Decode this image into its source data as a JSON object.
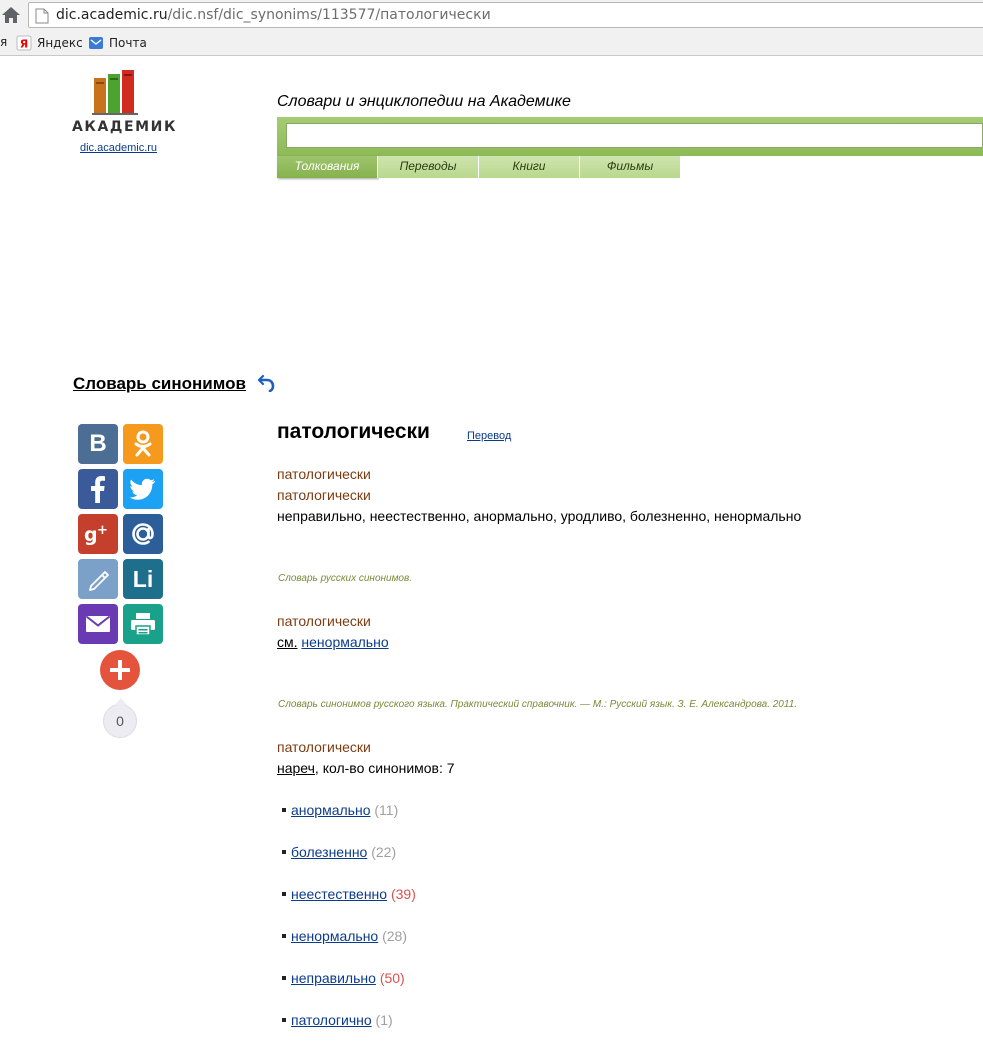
{
  "browser": {
    "url_host": "dic.academic.ru",
    "url_path": "/dic.nsf/dic_synonims/113577/патологически",
    "bookmarks": [
      {
        "label": "я"
      },
      {
        "label": "Яндекс"
      },
      {
        "label": "Почта"
      }
    ]
  },
  "header": {
    "logo_text": "АКАДЕМИК",
    "logo_link": "dic.academic.ru",
    "site_title": "Словари и энциклопедии на Академике",
    "search": {
      "value": ""
    },
    "tabs": [
      {
        "label": "Толкования"
      },
      {
        "label": "Переводы"
      },
      {
        "label": "Книги"
      },
      {
        "label": "Фильмы"
      }
    ]
  },
  "dictionary": {
    "name": "Словарь синонимов"
  },
  "social": {
    "vk": "В",
    "livejournal": "Li",
    "share_count": "0"
  },
  "article": {
    "title": "патологически",
    "translate_link": "Перевод",
    "entry1": {
      "head1": "патологически",
      "head2": "патологически",
      "text": "неправильно, неестественно, анормально, уродливо, болезненно, ненормально",
      "source": "Словарь русских синонимов."
    },
    "entry2": {
      "head": "патологически",
      "see_label": "см.",
      "see_link": "ненормально",
      "source": "Словарь синонимов русского языка. Практический справочник. — М.: Русский язык. З. Е. Александрова. 2011."
    },
    "entry3": {
      "head": "патологически",
      "pos": "нареч",
      "count_text": ", кол-во синонимов: 7",
      "synonyms": [
        {
          "word": "анормально",
          "count": "(11)"
        },
        {
          "word": "болезненно",
          "count": "(22)"
        },
        {
          "word": "неестественно",
          "count": "(39)"
        },
        {
          "word": "ненормально",
          "count": "(28)"
        },
        {
          "word": "неправильно",
          "count": "(50)"
        },
        {
          "word": "патологично",
          "count": "(1)"
        }
      ]
    }
  }
}
